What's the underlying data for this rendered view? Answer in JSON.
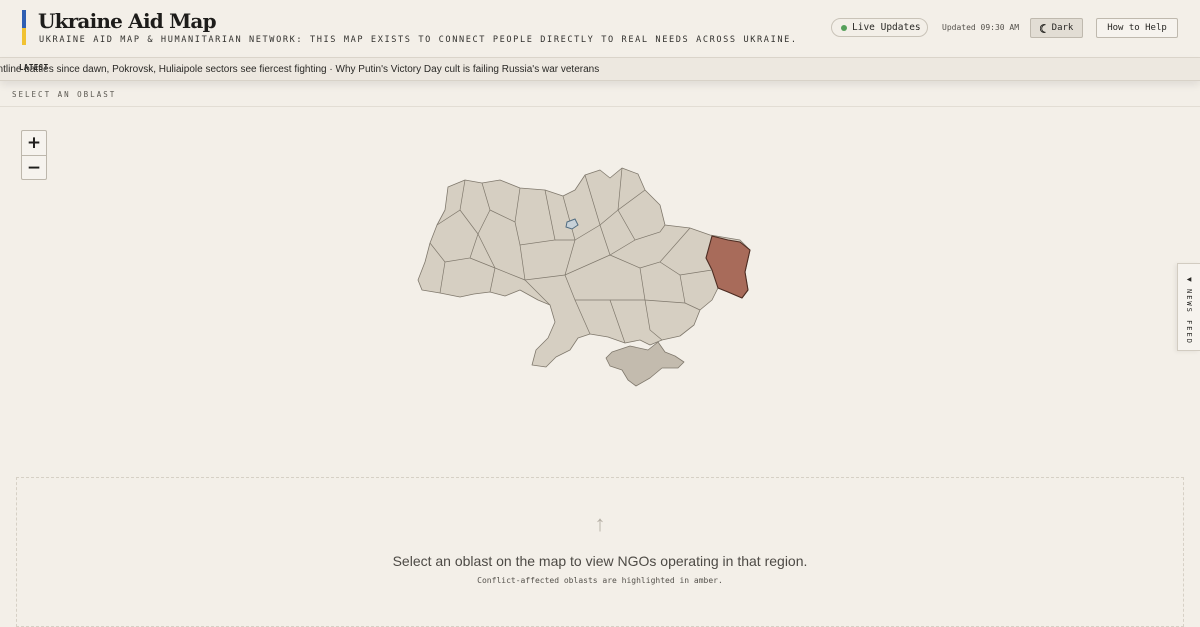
{
  "header": {
    "title": "Ukraine Aid Map",
    "subtitle": "UKRAINE AID MAP & HUMANITARIAN NETWORK: THIS MAP EXISTS TO CONNECT PEOPLE DIRECTLY TO REAL NEEDS ACROSS UKRAINE.",
    "live_label": "Live Updates",
    "updated": "Updated 09:30 AM",
    "dark_label": "Dark",
    "help_label": "How to Help",
    "flag_colors": [
      "#2f5fb3",
      "#f1c232"
    ]
  },
  "ticker": {
    "label": "LATEST",
    "text": "ontline battles since dawn, Pokrovsk, Huliaipole sectors see fiercest fighting · Why Putin's Victory Day cult is failing Russia's war veterans"
  },
  "map": {
    "select_label": "SELECT AN OBLAST",
    "zoom_in": "+",
    "zoom_out": "−",
    "highlighted_oblast_color": "#a86b5a",
    "oblast_fill": "#d6cfc2",
    "crimea_fill": "#c3bbae"
  },
  "newsfeed": {
    "label": "NEWS FEED",
    "icon": "triangle-left-icon"
  },
  "panel": {
    "icon": "arrow-up-icon",
    "title": "Select an oblast on the map to view NGOs operating in that region.",
    "subtitle": "Conflict-affected oblasts are highlighted in amber."
  }
}
